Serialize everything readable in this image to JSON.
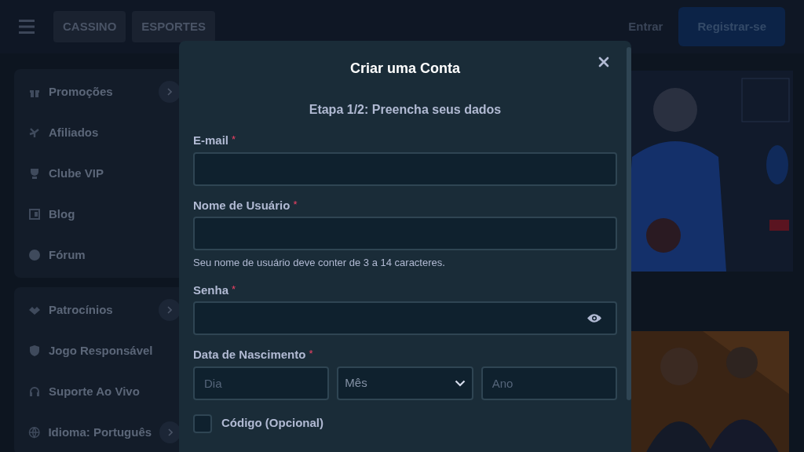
{
  "topbar": {
    "tabs": [
      {
        "label": "CASSINO"
      },
      {
        "label": "ESPORTES"
      }
    ],
    "login": "Entrar",
    "register": "Registrar-se"
  },
  "sidebar": {
    "groups": [
      {
        "items": [
          {
            "label": "Promoções",
            "expandable": true
          },
          {
            "label": "Afiliados",
            "expandable": false
          },
          {
            "label": "Clube VIP",
            "expandable": false
          },
          {
            "label": "Blog",
            "expandable": false
          },
          {
            "label": "Fórum",
            "expandable": false
          }
        ]
      },
      {
        "items": [
          {
            "label": "Patrocínios",
            "expandable": true
          },
          {
            "label": "Jogo Responsável",
            "expandable": false
          },
          {
            "label": "Suporte Ao Vivo",
            "expandable": false
          },
          {
            "label": "Idioma: Português",
            "expandable": true
          }
        ]
      }
    ]
  },
  "modal": {
    "title": "Criar uma Conta",
    "subtitle": "Etapa 1/2: Preencha seus dados",
    "fields": [
      {
        "kind": "text",
        "label": "E-mail",
        "required_mark": "*"
      },
      {
        "kind": "text",
        "label": "Nome de Usuário",
        "required_mark": "*",
        "hint": "Seu nome de usuário deve conter de 3 a 14 caracteres."
      },
      {
        "kind": "password",
        "label": "Senha",
        "required_mark": "*"
      },
      {
        "kind": "date",
        "label": "Data de Nascimento",
        "required_mark": "*",
        "parts": [
          {
            "kind": "text",
            "placeholder": "Dia"
          },
          {
            "kind": "select",
            "placeholder": "Mês"
          },
          {
            "kind": "text",
            "placeholder": "Ano"
          }
        ]
      }
    ],
    "checkbox": {
      "label": "Código (Opcional)",
      "checked": false
    }
  }
}
